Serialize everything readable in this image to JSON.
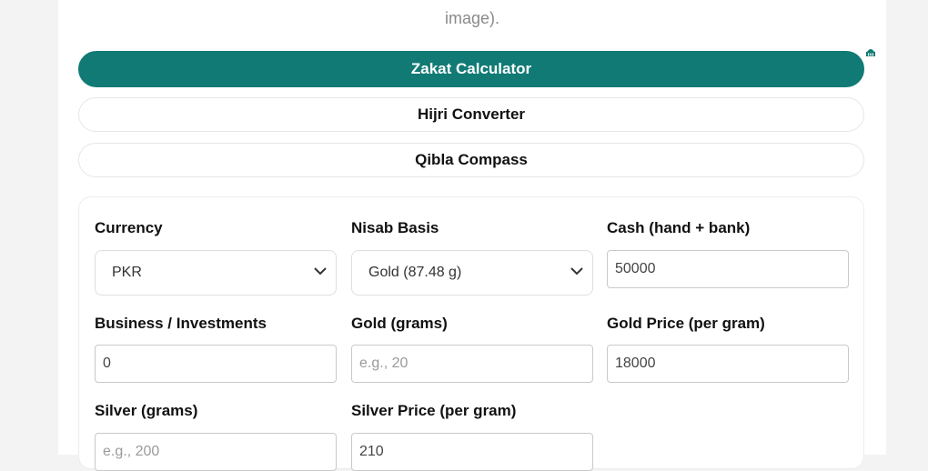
{
  "header": {
    "caption": "image)."
  },
  "tabs": [
    {
      "label": "Zakat Calculator",
      "active": true
    },
    {
      "label": "Hijri Converter",
      "active": false
    },
    {
      "label": "Qibla Compass",
      "active": false
    }
  ],
  "form": {
    "currency": {
      "label": "Currency",
      "value": "PKR"
    },
    "nisab": {
      "label": "Nisab Basis",
      "value": "Gold (87.48 g)"
    },
    "cash": {
      "label": "Cash (hand + bank)",
      "value": "50000"
    },
    "business": {
      "label": "Business / Investments",
      "value": "0"
    },
    "gold_grams": {
      "label": "Gold (grams)",
      "placeholder": "e.g., 20"
    },
    "gold_price": {
      "label": "Gold Price (per gram)",
      "value": "18000"
    },
    "silver_grams": {
      "label": "Silver (grams)",
      "placeholder": "e.g., 200"
    },
    "silver_price": {
      "label": "Silver Price (per gram)",
      "value": "210"
    }
  },
  "icons": {
    "corner": "mosque-icon",
    "select_arrow": "chevron-down-icon"
  },
  "colors": {
    "accent": "#117a74"
  }
}
